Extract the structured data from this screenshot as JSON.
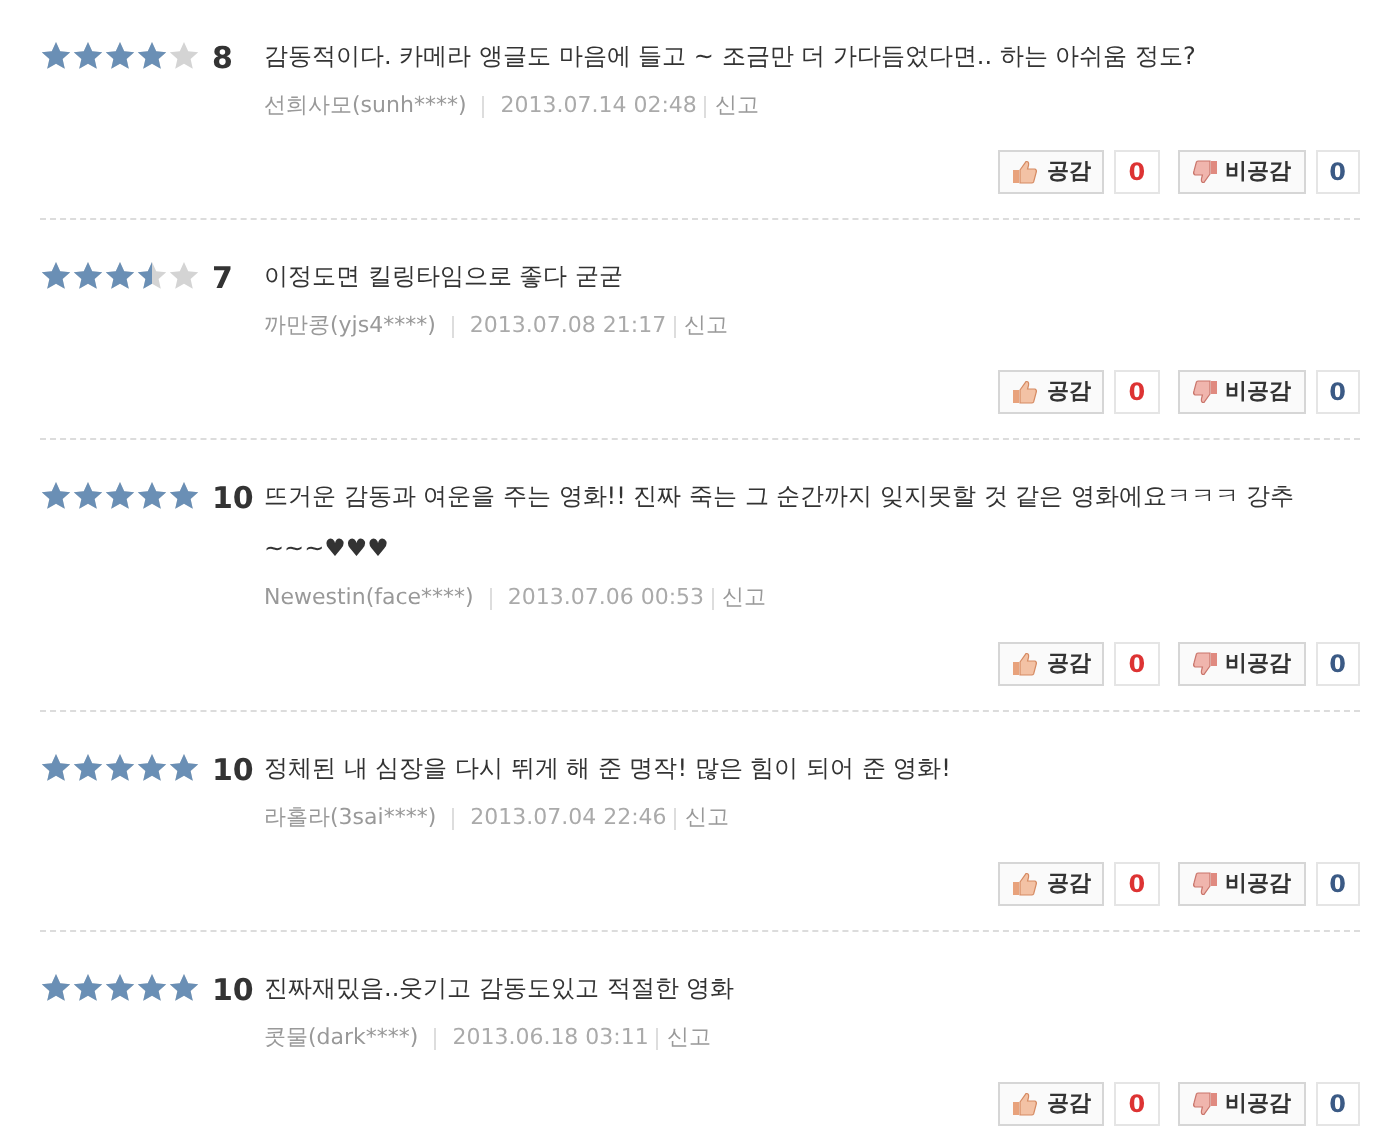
{
  "reviews": [
    {
      "stars": 4,
      "score": "8",
      "text": "감동적이다. 카메라 앵글도 마음에 들고 ~ 조금만 더 가다듬었다면.. 하는 아쉬움 정도?",
      "author": "선희사모(sunh****)",
      "date": "2013.07.14 02:48",
      "report": "신고",
      "like_label": "공감",
      "like_count": "0",
      "dislike_label": "비공감",
      "dislike_count": "0"
    },
    {
      "stars": 3.5,
      "score": "7",
      "text": "이정도면 킬링타임으로 좋다 굳굳",
      "author": "까만콩(yjs4****)",
      "date": "2013.07.08 21:17",
      "report": "신고",
      "like_label": "공감",
      "like_count": "0",
      "dislike_label": "비공감",
      "dislike_count": "0"
    },
    {
      "stars": 5,
      "score": "10",
      "text": "뜨거운 감동과 여운을 주는 영화!! 진짜 죽는 그 순간까지 잊지못할 것 같은 영화에요ㅋㅋㅋ 강추~~~♥♥♥",
      "author": "Newestin(face****)",
      "date": "2013.07.06 00:53",
      "report": "신고",
      "like_label": "공감",
      "like_count": "0",
      "dislike_label": "비공감",
      "dislike_count": "0"
    },
    {
      "stars": 5,
      "score": "10",
      "text": "정체된 내 심장을 다시 뛰게 해 준 명작! 많은 힘이 되어 준 영화!",
      "author": "라홀라(3sai****)",
      "date": "2013.07.04 22:46",
      "report": "신고",
      "like_label": "공감",
      "like_count": "0",
      "dislike_label": "비공감",
      "dislike_count": "0"
    },
    {
      "stars": 5,
      "score": "10",
      "text": "진짜재밌음..웃기고 감동도있고 적절한 영화",
      "author": "콧물(dark****)",
      "date": "2013.06.18 03:11",
      "report": "신고",
      "like_label": "공감",
      "like_count": "0",
      "dislike_label": "비공감",
      "dislike_count": "0"
    }
  ]
}
